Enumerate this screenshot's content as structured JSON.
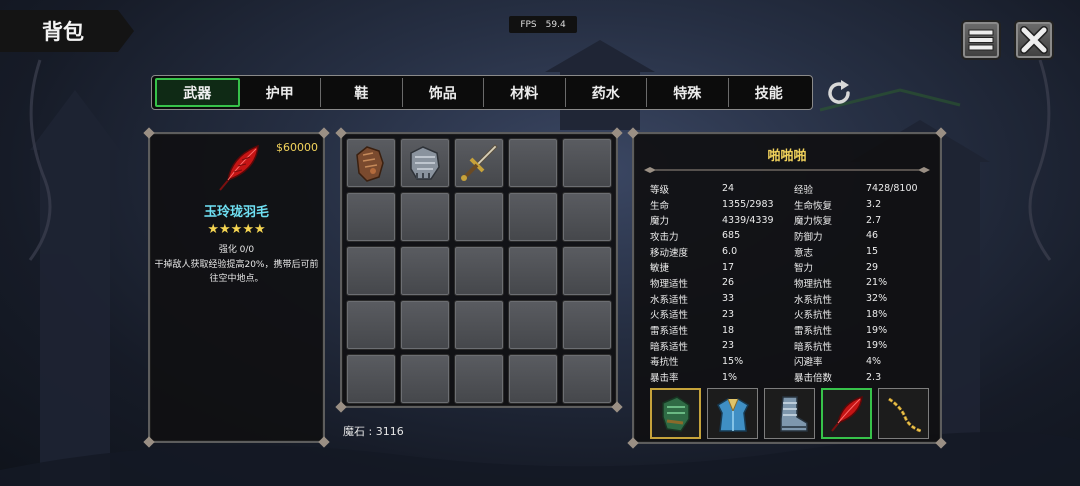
{
  "header": {
    "title": "背包"
  },
  "fps": {
    "label": "FPS",
    "value": "59.4"
  },
  "top_buttons": {
    "menu_icon": "menu-icon",
    "close_icon": "close-icon"
  },
  "tabs": [
    {
      "label": "武器",
      "active": true
    },
    {
      "label": "护甲",
      "active": false
    },
    {
      "label": "鞋",
      "active": false
    },
    {
      "label": "饰品",
      "active": false
    },
    {
      "label": "材料",
      "active": false
    },
    {
      "label": "药水",
      "active": false
    },
    {
      "label": "特殊",
      "active": false
    },
    {
      "label": "技能",
      "active": false
    }
  ],
  "refresh_icon": "refresh-icon",
  "item_detail": {
    "price": "$60000",
    "icon": "red-feather-icon",
    "name": "玉玲珑羽毛",
    "stars": "★★★★★",
    "star_count": 5,
    "enhance": "强化 0/0",
    "description": "干掉敌人获取经验提高20%，携带后可前往空中地点。"
  },
  "inventory": {
    "slots": [
      "leather-gauntlet-icon",
      "steel-gauntlet-icon",
      "sword-icon",
      "",
      "",
      "",
      "",
      "",
      "",
      "",
      "",
      "",
      "",
      "",
      "",
      "",
      "",
      "",
      "",
      "",
      "",
      "",
      "",
      "",
      ""
    ]
  },
  "mana_stone": {
    "text": "魔石 : 3116"
  },
  "character": {
    "name": "啪啪啪",
    "stats": [
      [
        "等级",
        "24",
        "经验",
        "7428/8100"
      ],
      [
        "生命",
        "1355/2983",
        "生命恢复",
        "3.2"
      ],
      [
        "魔力",
        "4339/4339",
        "魔力恢复",
        "2.7"
      ],
      [
        "攻击力",
        "685",
        "防御力",
        "46"
      ],
      [
        "移动速度",
        "6.0",
        "意志",
        "15"
      ],
      [
        "敏捷",
        "17",
        "智力",
        "29"
      ],
      [
        "物理适性",
        "26",
        "物理抗性",
        "21%"
      ],
      [
        "水系适性",
        "33",
        "水系抗性",
        "32%"
      ],
      [
        "火系适性",
        "23",
        "火系抗性",
        "18%"
      ],
      [
        "雷系适性",
        "18",
        "雷系抗性",
        "19%"
      ],
      [
        "暗系适性",
        "23",
        "暗系抗性",
        "19%"
      ],
      [
        "毒抗性",
        "15%",
        "闪避率",
        "4%"
      ],
      [
        "暴击率",
        "1%",
        "暴击倍数",
        "2.3"
      ]
    ],
    "equipment": [
      {
        "icon": "green-gauntlet-icon",
        "frame": "gold"
      },
      {
        "icon": "blue-armor-icon",
        "frame": "gray"
      },
      {
        "icon": "steel-boots-icon",
        "frame": "gray"
      },
      {
        "icon": "red-feather-icon",
        "frame": "green"
      },
      {
        "icon": "gold-chain-icon",
        "frame": "gray"
      }
    ]
  },
  "colors": {
    "active_tab": "#37c24a",
    "price": "#f2d35c",
    "item_name": "#6fe0f3",
    "char_name": "#f2d35c"
  }
}
